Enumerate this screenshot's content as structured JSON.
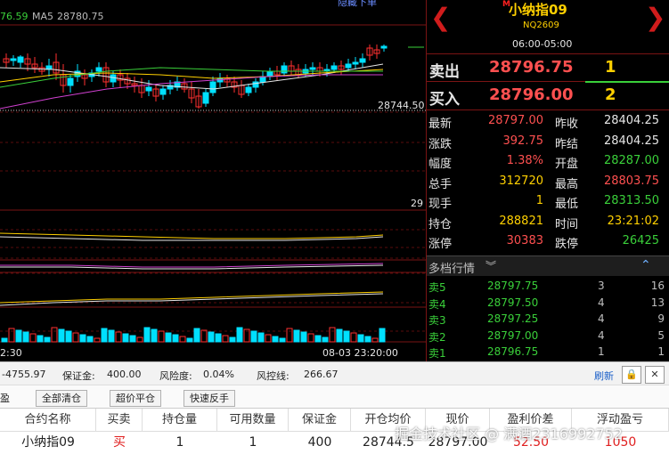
{
  "chart": {
    "ma_left_value": "76.59",
    "ma5_label": "MA5",
    "ma5_value": "28780.75",
    "top_right_text": "隐藏下单",
    "price_label_open": "28744.50",
    "axis_label_29": "29",
    "time_left": "2:30",
    "time_right": "08-03 23:20:00"
  },
  "panel": {
    "prev_icon": "chevron-left-icon",
    "next_icon": "chevron-right-icon",
    "badge": "M",
    "name": "小纳指09",
    "code": "NQ2609",
    "hours": "06:00-05:00",
    "ask": {
      "label": "卖出",
      "price": "28796.75",
      "qty": "1"
    },
    "bid": {
      "label": "买入",
      "price": "28796.00",
      "qty": "2"
    },
    "quotes": [
      {
        "l1": "最新",
        "v1": "28797.00",
        "c1": "#ff5050",
        "l2": "昨收",
        "v2": "28404.25",
        "c2": "#e6e6e6"
      },
      {
        "l1": "涨跌",
        "v1": "392.75",
        "c1": "#ff5050",
        "l2": "昨结",
        "v2": "28404.25",
        "c2": "#e6e6e6"
      },
      {
        "l1": "幅度",
        "v1": "1.38%",
        "c1": "#ff5050",
        "l2": "开盘",
        "v2": "28287.00",
        "c2": "#3ad03a"
      },
      {
        "l1": "总手",
        "v1": "312720",
        "c1": "#ffd000",
        "l2": "最高",
        "v2": "28803.75",
        "c2": "#ff5050"
      },
      {
        "l1": "现手",
        "v1": "1",
        "c1": "#ffd000",
        "l2": "最低",
        "v2": "28313.50",
        "c2": "#3ad03a"
      },
      {
        "l1": "持仓",
        "v1": "288821",
        "c1": "#ffd000",
        "l2": "时间",
        "v2": "23:21:02",
        "c2": "#ffd000"
      },
      {
        "l1": "涨停",
        "v1": "30383",
        "c1": "#ff5050",
        "l2": "跌停",
        "v2": "26425",
        "c2": "#3ad03a"
      }
    ],
    "depth_title": "多档行情",
    "depth": [
      {
        "name": "卖5",
        "price": "28797.75",
        "qty": "3",
        "total": "16"
      },
      {
        "name": "卖4",
        "price": "28797.50",
        "qty": "4",
        "total": "13"
      },
      {
        "name": "卖3",
        "price": "28797.25",
        "qty": "4",
        "total": "9"
      },
      {
        "name": "卖2",
        "price": "28797.00",
        "qty": "4",
        "total": "5"
      },
      {
        "name": "卖1",
        "price": "28796.75",
        "qty": "1",
        "total": "1"
      }
    ]
  },
  "account": {
    "balance": "-4755.97",
    "margin_label": "保证金:",
    "margin_value": "400.00",
    "risk_label": "风险度:",
    "risk_value": "0.04%",
    "control_label": "风控线:",
    "control_value": "266.67",
    "refresh": "刷新"
  },
  "toolbar": {
    "tab_left": "盈",
    "close_all": "全部清仓",
    "over_close": "超价平仓",
    "reverse": "快速反手"
  },
  "table": {
    "headers": [
      "合约名称",
      "买卖",
      "持仓量",
      "可用数量",
      "保证金",
      "开仓均价",
      "现价",
      "盈利价差",
      "浮动盈亏"
    ],
    "row": [
      "小纳指09",
      "买",
      "1",
      "1",
      "400",
      "28744.5",
      "28797.00",
      "52.50",
      "1050"
    ]
  },
  "watermark": "掘金技术社区 @ 满酒2316992752"
}
